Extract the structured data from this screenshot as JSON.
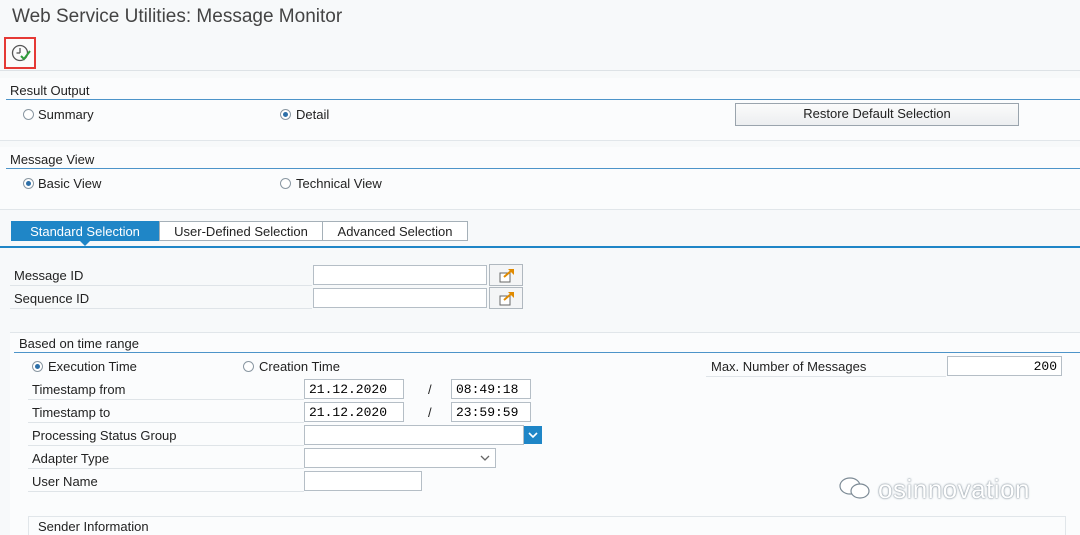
{
  "window": {
    "title": "Web Service Utilities: Message Monitor"
  },
  "toolbar": {
    "execute_icon": "execute-clock-icon"
  },
  "result_output": {
    "title": "Result Output",
    "options": [
      {
        "label": "Summary",
        "selected": false
      },
      {
        "label": "Detail",
        "selected": true
      }
    ],
    "restore_button": "Restore Default Selection"
  },
  "message_view": {
    "title": "Message View",
    "options": [
      {
        "label": "Basic View",
        "selected": true
      },
      {
        "label": "Technical View",
        "selected": false
      }
    ]
  },
  "tabs": [
    {
      "label": "Standard Selection",
      "active": true
    },
    {
      "label": "User-Defined Selection",
      "active": false
    },
    {
      "label": "Advanced Selection",
      "active": false
    }
  ],
  "ids": {
    "message_id_label": "Message ID",
    "message_id_value": "",
    "sequence_id_label": "Sequence ID",
    "sequence_id_value": "",
    "multi_select_icon": "multiple-selection-icon"
  },
  "time_range": {
    "title": "Based on time range",
    "execution_time_label": "Execution Time",
    "execution_time_selected": true,
    "creation_time_label": "Creation Time",
    "creation_time_selected": false,
    "timestamp_from_label": "Timestamp from",
    "timestamp_from_date": "21.12.2020",
    "timestamp_from_time": "08:49:18",
    "timestamp_to_label": "Timestamp to",
    "timestamp_to_date": "21.12.2020",
    "timestamp_to_time": "23:59:59",
    "separator": "/",
    "processing_status_label": "Processing Status Group",
    "processing_status_value": "",
    "adapter_type_label": "Adapter Type",
    "adapter_type_value": "",
    "user_name_label": "User Name",
    "user_name_value": "",
    "max_messages_label": "Max. Number of Messages",
    "max_messages_value": "200"
  },
  "sender": {
    "title": "Sender Information"
  },
  "watermark": {
    "text": "osinnovation"
  },
  "colors": {
    "accent": "#1f86c7",
    "highlight_border": "#e53935"
  }
}
